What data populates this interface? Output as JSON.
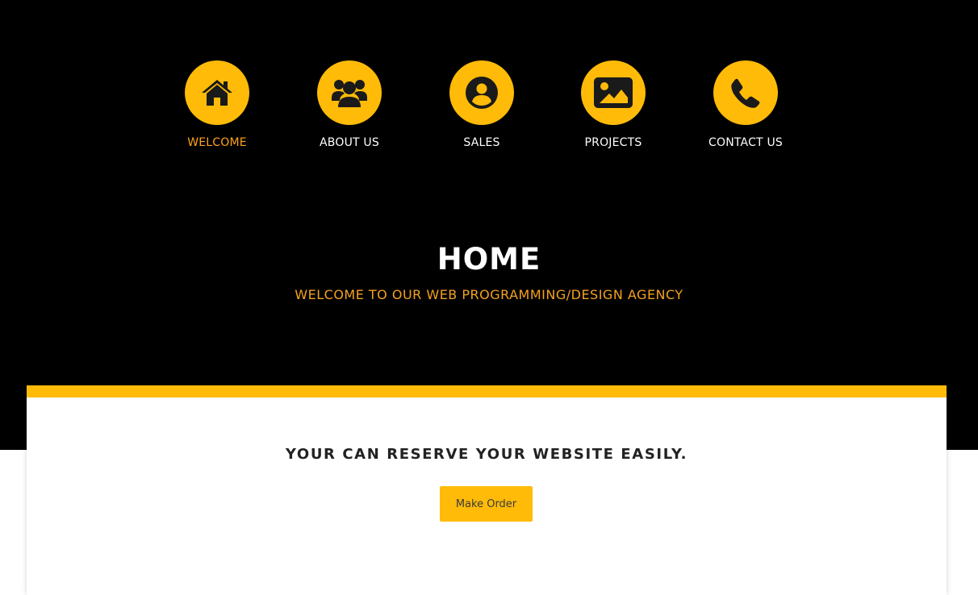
{
  "colors": {
    "accent": "#ffbb08",
    "active_label": "#ffa21a",
    "subtitle": "#f4a11f",
    "hero_background": "#000000"
  },
  "nav": {
    "items": [
      {
        "label": "WELCOME",
        "icon": "home-icon",
        "active": true
      },
      {
        "label": "ABOUT US",
        "icon": "users-icon",
        "active": false
      },
      {
        "label": "SALES",
        "icon": "user-circle-icon",
        "active": false
      },
      {
        "label": "PROJECTS",
        "icon": "image-icon",
        "active": false
      },
      {
        "label": "CONTACT US",
        "icon": "phone-icon",
        "active": false
      }
    ]
  },
  "hero": {
    "title": "HOME",
    "subtitle": "WELCOME TO OUR WEB PROGRAMMING/DESIGN AGENCY"
  },
  "card": {
    "heading": "YOUR CAN RESERVE YOUR WEBSITE EASILY.",
    "button_label": "Make Order"
  }
}
